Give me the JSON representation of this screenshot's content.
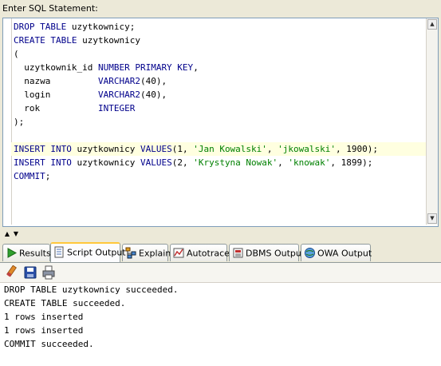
{
  "editor": {
    "label": "Enter SQL Statement:",
    "lines": [
      [
        {
          "t": "DROP TABLE",
          "c": "kw"
        },
        {
          "t": " uzytkownicy;",
          "c": ""
        }
      ],
      [
        {
          "t": "CREATE TABLE",
          "c": "kw"
        },
        {
          "t": " uzytkownicy",
          "c": ""
        }
      ],
      [
        {
          "t": "(",
          "c": ""
        }
      ],
      [
        {
          "t": "  uzytkownik_id ",
          "c": ""
        },
        {
          "t": "NUMBER PRIMARY KEY",
          "c": "kw"
        },
        {
          "t": ",",
          "c": ""
        }
      ],
      [
        {
          "t": "  nazwa         ",
          "c": ""
        },
        {
          "t": "VARCHAR2",
          "c": "kw"
        },
        {
          "t": "(40),",
          "c": ""
        }
      ],
      [
        {
          "t": "  login         ",
          "c": ""
        },
        {
          "t": "VARCHAR2",
          "c": "kw"
        },
        {
          "t": "(40),",
          "c": ""
        }
      ],
      [
        {
          "t": "  rok           ",
          "c": ""
        },
        {
          "t": "INTEGER",
          "c": "kw"
        }
      ],
      [
        {
          "t": ");",
          "c": ""
        }
      ],
      [
        {
          "t": "",
          "c": ""
        }
      ],
      [
        {
          "t": "INSERT INTO",
          "c": "kw"
        },
        {
          "t": " uzytkownicy ",
          "c": ""
        },
        {
          "t": "VALUES",
          "c": "kw"
        },
        {
          "t": "(1, ",
          "c": ""
        },
        {
          "t": "'Jan Kowalski'",
          "c": "str"
        },
        {
          "t": ", ",
          "c": ""
        },
        {
          "t": "'jkowalski'",
          "c": "str"
        },
        {
          "t": ", 1900);",
          "c": ""
        }
      ],
      [
        {
          "t": "INSERT INTO",
          "c": "kw"
        },
        {
          "t": " uzytkownicy ",
          "c": ""
        },
        {
          "t": "VALUES",
          "c": "kw"
        },
        {
          "t": "(2, ",
          "c": ""
        },
        {
          "t": "'Krystyna Nowak'",
          "c": "str"
        },
        {
          "t": ", ",
          "c": ""
        },
        {
          "t": "'knowak'",
          "c": "str"
        },
        {
          "t": ", 1899);",
          "c": ""
        }
      ],
      [
        {
          "t": "COMMIT",
          "c": "kw"
        },
        {
          "t": ";",
          "c": ""
        }
      ]
    ],
    "highlighted_line": 9
  },
  "tabs": [
    {
      "label": "Results",
      "icon": "run-icon",
      "active": false
    },
    {
      "label": "Script Output",
      "icon": "script-icon",
      "active": true
    },
    {
      "label": "Explain",
      "icon": "explain-icon",
      "active": false
    },
    {
      "label": "Autotrace",
      "icon": "autotrace-icon",
      "active": false
    },
    {
      "label": "DBMS Output",
      "icon": "dbms-icon",
      "active": false
    },
    {
      "label": "OWA Output",
      "icon": "owa-icon",
      "active": false
    }
  ],
  "toolbar": {
    "buttons": [
      {
        "name": "eraser-icon"
      },
      {
        "name": "save-icon"
      },
      {
        "name": "print-icon"
      }
    ]
  },
  "output": {
    "lines": [
      "DROP TABLE uzytkownicy succeeded.",
      "CREATE TABLE succeeded.",
      "1 rows inserted",
      "1 rows inserted",
      "COMMIT succeeded."
    ]
  },
  "colors": {
    "keyword": "#00008b",
    "string": "#008000",
    "highlight": "#ffffe0",
    "active_tab_accent": "#ffc83c"
  }
}
